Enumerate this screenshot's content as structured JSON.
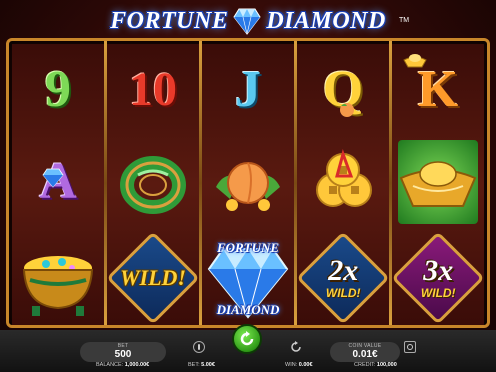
{
  "game": {
    "title_left": "FORTUNE",
    "title_right": "DIAMOND",
    "trademark": "TM"
  },
  "reels": [
    {
      "symbols": [
        {
          "id": "9",
          "text": "9"
        },
        {
          "id": "A",
          "text": "A",
          "icon": "diamond-icon"
        },
        {
          "id": "pot-of-gold",
          "icon": "pot-of-gold-icon"
        }
      ]
    },
    {
      "symbols": [
        {
          "id": "10",
          "text": "10"
        },
        {
          "id": "jade-ring",
          "icon": "jade-ring-icon"
        },
        {
          "id": "wild",
          "text": "WILD!"
        }
      ]
    },
    {
      "symbols": [
        {
          "id": "J",
          "text": "J"
        },
        {
          "id": "peach",
          "icon": "peach-icon"
        },
        {
          "id": "fortune-diamond",
          "text_top": "FORTUNE",
          "text_bottom": "DIAMOND"
        }
      ]
    },
    {
      "symbols": [
        {
          "id": "Q",
          "text": "Q",
          "icon": "peach-icon"
        },
        {
          "id": "coins",
          "icon": "coins-icon"
        },
        {
          "id": "wild-2x",
          "multiplier": "2x",
          "text": "WILD!"
        }
      ]
    },
    {
      "symbols": [
        {
          "id": "K",
          "text": "K",
          "icon": "gold-ingot-icon"
        },
        {
          "id": "gold-ingot",
          "icon": "gold-ingot-icon"
        },
        {
          "id": "wild-3x",
          "multiplier": "3x",
          "text": "WILD!"
        }
      ]
    }
  ],
  "controls": {
    "bet": {
      "label": "BET",
      "value": "500"
    },
    "coin_value": {
      "label": "COIN VALUE",
      "value": "0.01€"
    },
    "balance": {
      "label": "BALANCE:",
      "value": "1,000.00€"
    },
    "bet_amount": {
      "label": "BET:",
      "value": "5.00€"
    },
    "win": {
      "label": "WIN:",
      "value": "0.00€"
    },
    "credit": {
      "label": "CREDIT:",
      "value": "100,000"
    }
  },
  "colors": {
    "frame_gold": "#c8862a",
    "spin_green": "#2f9a18",
    "title_blue": "#1a3fb0"
  }
}
